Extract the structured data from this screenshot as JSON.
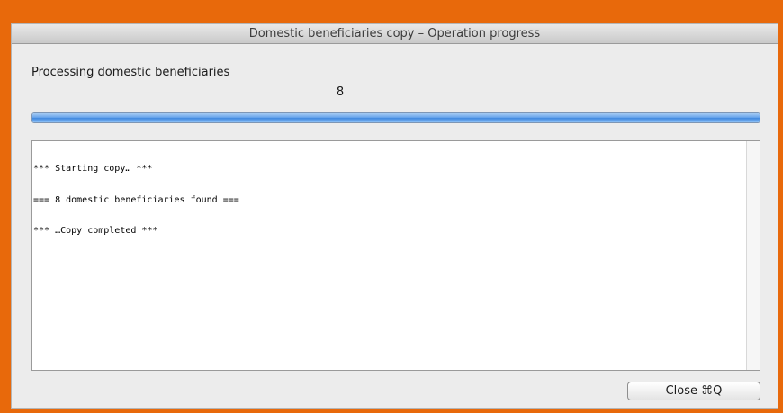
{
  "window": {
    "title": "Domestic beneficiaries copy – Operation progress"
  },
  "main": {
    "heading": "Processing domestic beneficiaries",
    "count": "8",
    "progress_percent": 100,
    "log_lines": [
      "*** Starting copy… ***",
      "=== 8 domestic beneficiaries found ===",
      "*** …Copy completed ***"
    ]
  },
  "footer": {
    "close_label": "Close ⌘Q"
  },
  "colors": {
    "background_accent": "#e8690b",
    "progress_blue": "#4a8fe0"
  }
}
